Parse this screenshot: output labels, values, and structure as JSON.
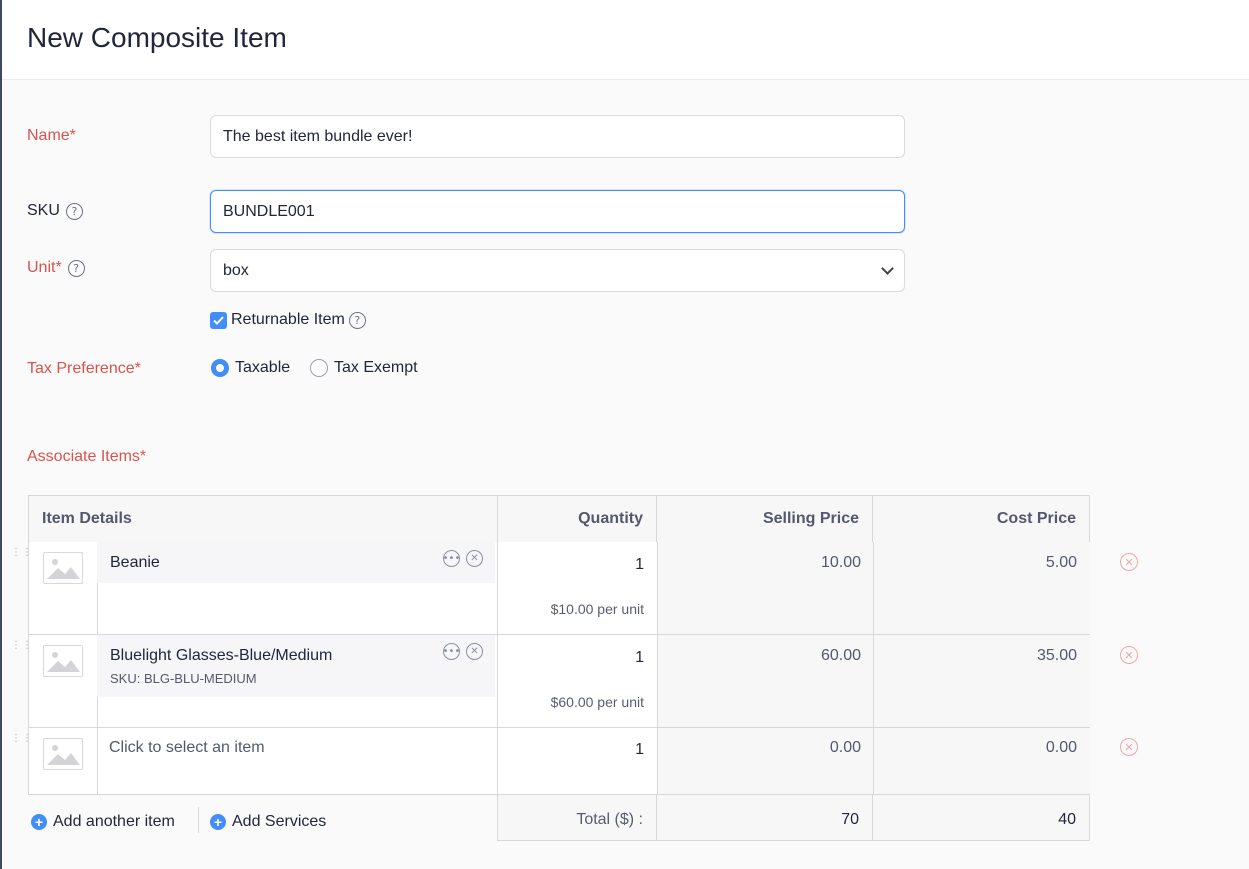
{
  "page": {
    "title": "New Composite Item"
  },
  "form": {
    "name": {
      "label": "Name*",
      "value": "The best item bundle ever!"
    },
    "sku": {
      "label": "SKU",
      "value": "BUNDLE001"
    },
    "unit": {
      "label": "Unit*",
      "value": "box"
    },
    "returnable": {
      "label": "Returnable Item",
      "checked": true
    },
    "tax": {
      "label": "Tax Preference*",
      "options": [
        "Taxable",
        "Tax Exempt"
      ],
      "selected": "Taxable"
    }
  },
  "associate": {
    "label": "Associate Items*",
    "columns": [
      "Item Details",
      "Quantity",
      "Selling Price",
      "Cost Price"
    ],
    "rows": [
      {
        "name": "Beanie",
        "sku": "",
        "qty": "1",
        "per_unit": "$10.00 per unit",
        "selling": "10.00",
        "cost": "5.00"
      },
      {
        "name": "Bluelight Glasses-Blue/Medium",
        "sku": "SKU: BLG-BLU-MEDIUM",
        "qty": "1",
        "per_unit": "$60.00 per unit",
        "selling": "60.00",
        "cost": "35.00"
      },
      {
        "name": "Click to select an item",
        "sku": "",
        "qty": "1",
        "per_unit": "",
        "selling": "0.00",
        "cost": "0.00"
      }
    ],
    "add_item": "Add another item",
    "add_services": "Add Services",
    "total_label": "Total ($) :",
    "total_selling": "70",
    "total_cost": "40"
  }
}
